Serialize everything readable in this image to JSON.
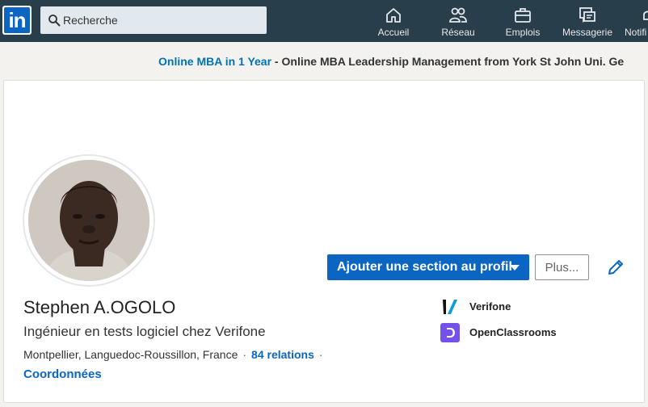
{
  "nav": {
    "search_placeholder": "Recherche",
    "items": [
      {
        "label": "Accueil",
        "icon": "home-icon"
      },
      {
        "label": "Réseau",
        "icon": "network-icon"
      },
      {
        "label": "Emplois",
        "icon": "briefcase-icon"
      },
      {
        "label": "Messagerie",
        "icon": "messaging-icon"
      },
      {
        "label": "Notifi",
        "icon": "bell-icon"
      }
    ],
    "logo": "in"
  },
  "ad": {
    "highlight": "Online MBA in 1 Year",
    "sep": " - ",
    "text": "Online MBA Leadership Management from York St John Uni. Ge"
  },
  "profile": {
    "name": "Stephen A.OGOLO",
    "headline": "Ingénieur en tests logiciel chez Verifone",
    "location": "Montpellier, Languedoc-Roussillon, France",
    "dot": "·",
    "relations": "84 relations",
    "coordinates_link": "Coordonnées",
    "add_section_label": "Ajouter une section au profil",
    "more_label": "Plus...",
    "orgs": [
      {
        "name": "Verifone",
        "icon": "verifone-logo"
      },
      {
        "name": "OpenClassrooms",
        "icon": "openclassrooms-logo"
      }
    ]
  },
  "colors": {
    "nav_bg": "#283e4a",
    "accent": "#0a66c2",
    "page_bg": "#f3f2ef"
  }
}
